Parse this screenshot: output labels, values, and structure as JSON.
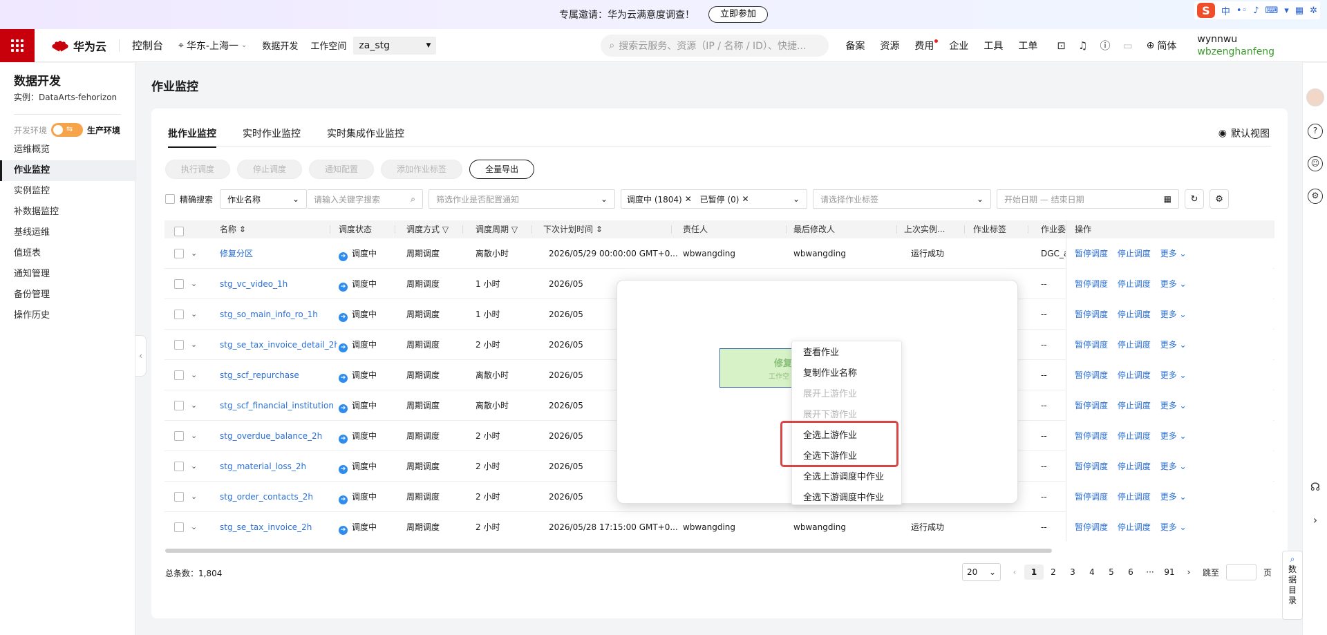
{
  "banner": {
    "text": "专属邀请：华为云满意度调查！",
    "button": "立即参加"
  },
  "ime": {
    "lang": "中"
  },
  "topnav": {
    "brand": "华为云",
    "console": "控制台",
    "region": "华东-上海一",
    "data_dev": "数据开发",
    "workspace_label": "工作空间",
    "workspace": "za_stg",
    "search_placeholder": "搜索云服务、资源（IP / 名称 / ID）、快捷...",
    "links": [
      "备案",
      "资源",
      "费用",
      "企业",
      "工具",
      "工单"
    ],
    "language": "简体",
    "user": "wynnwu",
    "account": "wbzenghanfeng"
  },
  "sidebar": {
    "title": "数据开发",
    "instance": "实例：DataArts-fehorizon",
    "env_dev": "开发环境",
    "env_prod": "生产环境",
    "items": [
      "运维概览",
      "作业监控",
      "实例监控",
      "补数据监控",
      "基线运维",
      "值班表",
      "通知管理",
      "备份管理",
      "操作历史"
    ]
  },
  "main": {
    "title": "作业监控",
    "tabs": [
      "批作业监控",
      "实时作业监控",
      "实时集成作业监控"
    ],
    "default_view": "默认视图",
    "toolbar": [
      "执行调度",
      "停止调度",
      "通知配置",
      "添加作业标签",
      "全量导出"
    ],
    "filters": {
      "exact_search": "精确搜索",
      "field": "作业名称",
      "keyword_placeholder": "请输入关键字搜索",
      "notify_placeholder": "筛选作业是否配置通知",
      "chip1": "调度中 (1804)",
      "chip2": "已暂停 (0)",
      "tag_placeholder": "请选择作业标签",
      "date_placeholder": "开始日期 — 结束日期"
    },
    "columns": [
      "名称",
      "调度状态",
      "调度方式",
      "调度周期",
      "下次计划时间",
      "责任人",
      "最后修改人",
      "上次实例...",
      "作业标签",
      "作业委",
      "操作"
    ],
    "rows": [
      {
        "name": "修复分区",
        "status": "调度中",
        "mode": "周期调度",
        "cycle": "离散小时",
        "next": "2026/05/29 00:00:00 GMT+0...",
        "owner": "wbwangding",
        "modifier": "wbwangding",
        "last": "运行成功",
        "delegate": "DGC_a"
      },
      {
        "name": "stg_vc_video_1h",
        "status": "调度中",
        "mode": "周期调度",
        "cycle": "1 小时",
        "next": "2026/05",
        "owner": "",
        "modifier": "",
        "last": "",
        "delegate": "--"
      },
      {
        "name": "stg_so_main_info_ro_1h",
        "status": "调度中",
        "mode": "周期调度",
        "cycle": "1 小时",
        "next": "2026/05",
        "owner": "",
        "modifier": "",
        "last": "",
        "delegate": "--"
      },
      {
        "name": "stg_se_tax_invoice_detail_2h",
        "status": "调度中",
        "mode": "周期调度",
        "cycle": "2 小时",
        "next": "2026/05",
        "owner": "",
        "modifier": "",
        "last": "",
        "delegate": "--"
      },
      {
        "name": "stg_scf_repurchase",
        "status": "调度中",
        "mode": "周期调度",
        "cycle": "离散小时",
        "next": "2026/05",
        "owner": "",
        "modifier": "",
        "last": "",
        "delegate": "--"
      },
      {
        "name": "stg_scf_financial_institution",
        "status": "调度中",
        "mode": "周期调度",
        "cycle": "离散小时",
        "next": "2026/05",
        "owner": "",
        "modifier": "",
        "last": "",
        "delegate": "--"
      },
      {
        "name": "stg_overdue_balance_2h",
        "status": "调度中",
        "mode": "周期调度",
        "cycle": "2 小时",
        "next": "2026/05",
        "owner": "",
        "modifier": "",
        "last": "",
        "delegate": "--"
      },
      {
        "name": "stg_material_loss_2h",
        "status": "调度中",
        "mode": "周期调度",
        "cycle": "2 小时",
        "next": "2026/05",
        "owner": "",
        "modifier": "",
        "last": "",
        "delegate": "--"
      },
      {
        "name": "stg_order_contacts_2h",
        "status": "调度中",
        "mode": "周期调度",
        "cycle": "2 小时",
        "next": "2026/05",
        "owner": "",
        "modifier": "",
        "last": "",
        "delegate": "--"
      },
      {
        "name": "stg_se_tax_invoice_2h",
        "status": "调度中",
        "mode": "周期调度",
        "cycle": "2 小时",
        "next": "2026/05/28 17:15:00 GMT+0...",
        "owner": "wbwangding",
        "modifier": "wbwangding",
        "last": "运行成功",
        "delegate": "--"
      }
    ],
    "ops": [
      "暂停调度",
      "停止调度",
      "更多"
    ],
    "footer": {
      "total": "总条数：1,804",
      "page_size": "20",
      "pages": [
        "1",
        "2",
        "3",
        "4",
        "5",
        "6",
        "···",
        "91"
      ],
      "jump": "跳至",
      "page_unit": "页"
    }
  },
  "popup": {
    "node_title": "修复",
    "node_sub": "工作空",
    "menu": [
      {
        "label": "查看作业",
        "disabled": false
      },
      {
        "label": "复制作业名称",
        "disabled": false
      },
      {
        "label": "展开上游作业",
        "disabled": true
      },
      {
        "label": "展开下游作业",
        "disabled": true
      },
      {
        "label": "全选上游作业",
        "disabled": false
      },
      {
        "label": "全选下游作业",
        "disabled": false
      },
      {
        "label": "全选上游调度中作业",
        "disabled": false
      },
      {
        "label": "全选下游调度中作业",
        "disabled": false
      }
    ]
  },
  "rightrail": {
    "data_dir": "数据目录"
  },
  "colors": {
    "brand_red": "#c7000b",
    "link_blue": "#2a6fd6",
    "highlight_red": "#d94545"
  }
}
